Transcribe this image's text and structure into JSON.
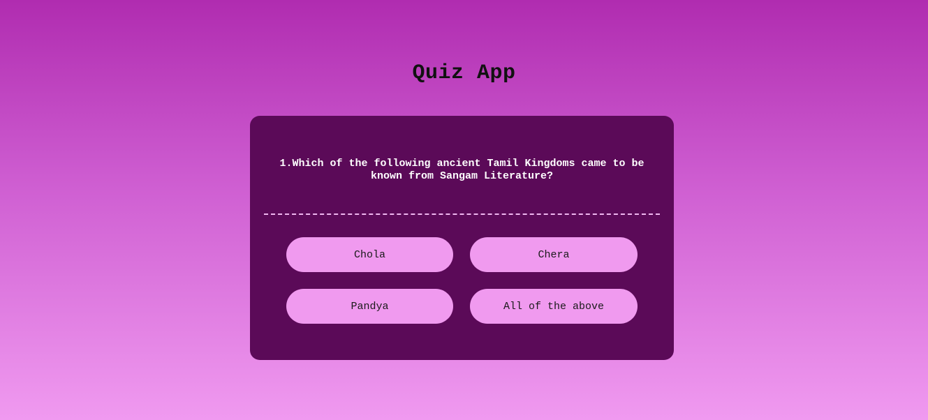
{
  "app": {
    "title": "Quiz App"
  },
  "quiz": {
    "question": "1.Which of the following ancient Tamil Kingdoms came to be known from Sangam Literature?",
    "options": [
      "Chola",
      "Chera",
      "Pandya",
      "All of the above"
    ]
  },
  "colors": {
    "background_top": "#b02cb0",
    "background_bottom": "#f09af0",
    "card": "#5b0a58",
    "option_button": "#f09aef",
    "question_text": "#ffffff"
  }
}
